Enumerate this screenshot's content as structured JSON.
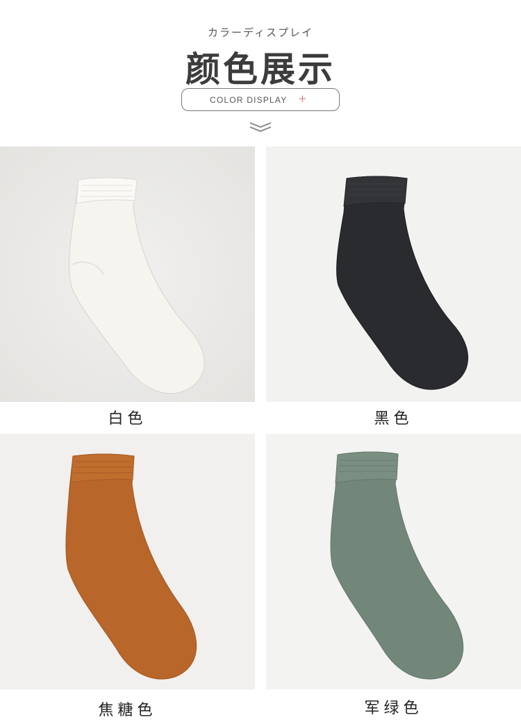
{
  "header": {
    "subtitle": "カラーディスプレイ",
    "title": "颜色展示",
    "badge": {
      "label": "COLOR DISPLAY",
      "plus": "+"
    },
    "scroll_icon": "double-chevron-down-icon"
  },
  "swatches": [
    {
      "name": "白色",
      "color": "#f5f4ef"
    },
    {
      "name": "黑色",
      "color": "#2a2b2e"
    },
    {
      "name": "焦糖色",
      "color": "#b8662a"
    },
    {
      "name": "军绿色",
      "color": "#72877a"
    }
  ]
}
